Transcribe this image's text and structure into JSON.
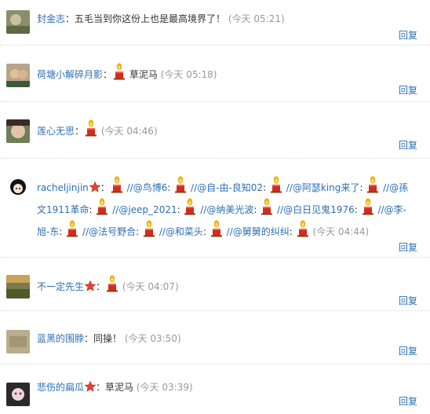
{
  "reply_label": "回复",
  "comments": [
    {
      "user": "封金志",
      "sep": "：",
      "text": "五毛当到你这份上也是最高境界了！",
      "time": "(今天 05:21)"
    },
    {
      "user": "荷塘小解碎月影",
      "sep": "：",
      "text": "草泥马",
      "time": "(今天 05:18)"
    },
    {
      "user": "莲心无思",
      "sep": "：",
      "text": "",
      "time": "(今天 04:46)"
    },
    {
      "user": "racheljinjin",
      "sep": "：",
      "time": "(今天 04:44)",
      "mentions": [
        "//@鸟博6",
        "//@自-由-良知02",
        "//@阿瑟king来了",
        "//@孫文1911革命",
        "//@jeep_2021",
        "//@纳美光波",
        "//@白日见鬼1976",
        "//@李-旭-东",
        "//@法号野合",
        "//@和菜头",
        "//@舅舅的纠纠"
      ],
      "mention_sep": ":"
    },
    {
      "user": "不一定先生",
      "sep": "：",
      "text": "",
      "time": "(今天 04:07)"
    },
    {
      "user": "蓝黑的围脖",
      "sep": "：",
      "text": "同操！",
      "time": "(今天 03:50)"
    },
    {
      "user": "悲伤的扁瓜",
      "sep": "：",
      "text": "草泥马",
      "time": "(今天 03:39)"
    }
  ],
  "icons": {
    "candle": "candle-emoticon-icon",
    "star": "verified-star-icon"
  },
  "colors": {
    "link": "#2b6fb6",
    "time": "#999999",
    "candle_red": "#d52b1e",
    "flame": "#f5a800"
  }
}
